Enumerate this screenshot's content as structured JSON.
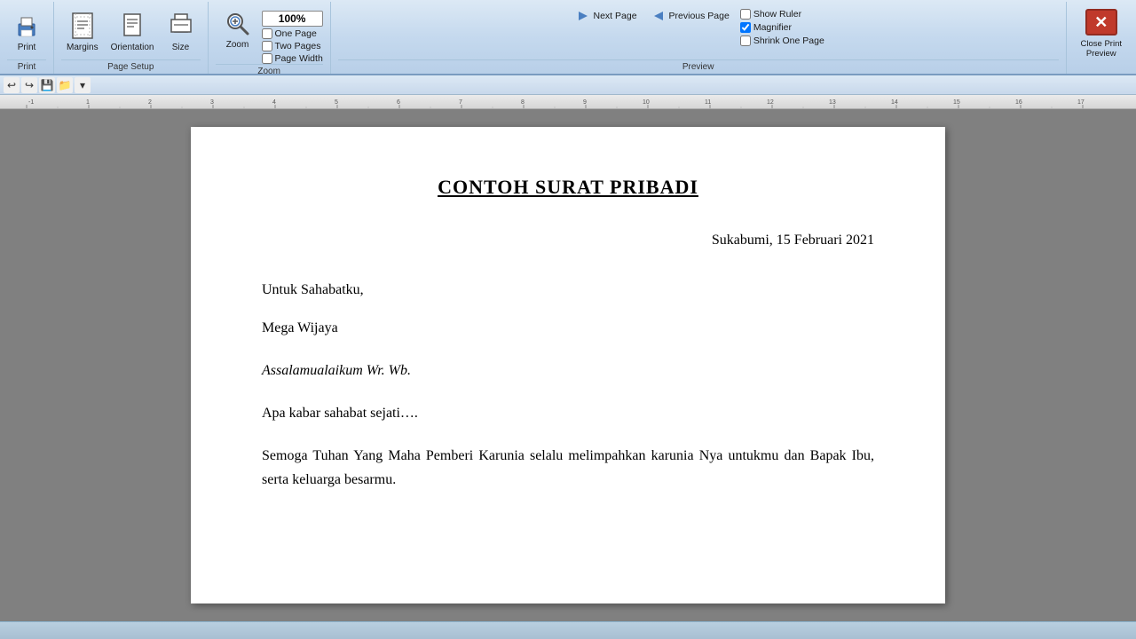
{
  "ribbon": {
    "sections": {
      "print": {
        "label": "Print",
        "buttons": [
          {
            "id": "print-btn",
            "icon": "🖨",
            "label": "Print"
          }
        ]
      },
      "page_setup": {
        "label": "Page Setup",
        "buttons": [
          {
            "id": "margins-btn",
            "icon": "📄",
            "label": "Margins"
          },
          {
            "id": "orientation-btn",
            "icon": "📄",
            "label": "Orientation"
          },
          {
            "id": "size-btn",
            "icon": "📄",
            "label": "Size"
          }
        ],
        "corner_icon": "↗"
      },
      "zoom": {
        "label": "Zoom",
        "buttons": [
          {
            "id": "zoom-btn",
            "icon": "🔍",
            "label": "Zoom"
          },
          {
            "id": "zoom-100-btn",
            "label": "100%"
          }
        ],
        "checkboxes": [
          {
            "id": "one-page",
            "label": "One Page",
            "checked": false
          },
          {
            "id": "two-pages",
            "label": "Two Pages",
            "checked": false
          },
          {
            "id": "page-width",
            "label": "Page Width",
            "checked": false
          }
        ]
      },
      "preview": {
        "label": "Preview",
        "magnifier_checked": true,
        "checkboxes": [
          {
            "id": "show-ruler",
            "label": "Show Ruler",
            "checked": false
          },
          {
            "id": "magnifier",
            "label": "Magnifier",
            "checked": true
          },
          {
            "id": "shrink-one-page",
            "label": "Shrink One Page",
            "checked": false
          }
        ],
        "buttons": [
          {
            "id": "next-page-btn",
            "label": "Next Page"
          },
          {
            "id": "prev-page-btn",
            "label": "Previous Page"
          }
        ]
      },
      "close": {
        "label": "Close Print\nPreview",
        "close_label_line1": "Close Print",
        "close_label_line2": "Preview"
      }
    }
  },
  "quick_access": {
    "buttons": [
      "↩",
      "↪",
      "💾",
      "📁",
      "▾"
    ]
  },
  "ruler": {
    "marks": [
      "-1",
      "1",
      "2",
      "3",
      "4",
      "5",
      "6",
      "7",
      "8",
      "9",
      "10",
      "11",
      "12",
      "13",
      "14",
      "15",
      "16",
      "17"
    ]
  },
  "document": {
    "title": "CONTOH SURAT PRIBADI",
    "date": "Sukabumi, 15 Februari 2021",
    "recipient": "Untuk Sahabatku,",
    "name": "Mega Wijaya",
    "greeting": "Assalamualaikum Wr. Wb.",
    "para1": "Apa kabar sahabat sejati….",
    "para2": "Semoga Tuhan Yang Maha Pemberi Karunia selalu melimpahkan karunia Nya untukmu dan Bapak Ibu, serta keluarga besarmu."
  },
  "status_bar": {
    "text": ""
  }
}
